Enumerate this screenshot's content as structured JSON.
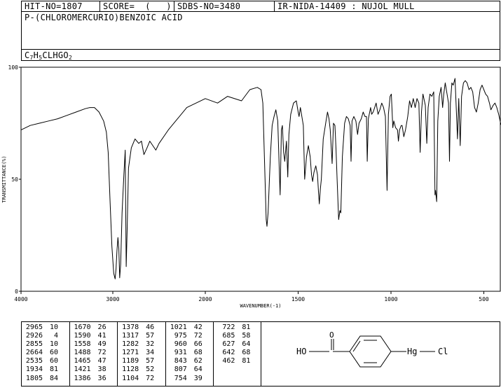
{
  "header": {
    "hit_no": "HIT-NO=1807",
    "score": "SCORE=  (   )",
    "sdbs_no": "SDBS-NO=3480",
    "ir_info": "IR-NIDA-14409 : NUJOL MULL"
  },
  "compound": {
    "name": "P-(CHLOROMERCURIO)BENZOIC ACID",
    "formula_parts": [
      "C",
      "7",
      "H",
      "5",
      "CLHGO",
      "2"
    ]
  },
  "chart_data": {
    "type": "line",
    "xlabel": "WAVENUMBER(-1)",
    "ylabel": "TRANSMITTANCE(%)",
    "xlim": [
      4000,
      400
    ],
    "ylim": [
      0,
      100
    ],
    "x_ticks": [
      4000,
      3000,
      2000,
      1500,
      1000,
      500
    ],
    "y_ticks": [
      0,
      50,
      100
    ],
    "grid": false,
    "series": [
      {
        "points": [
          [
            4000,
            72
          ],
          [
            3900,
            74
          ],
          [
            3800,
            75
          ],
          [
            3700,
            76
          ],
          [
            3600,
            77
          ],
          [
            3500,
            78.5
          ],
          [
            3400,
            80
          ],
          [
            3300,
            81.5
          ],
          [
            3250,
            82
          ],
          [
            3200,
            82
          ],
          [
            3150,
            80
          ],
          [
            3100,
            76
          ],
          [
            3070,
            71
          ],
          [
            3050,
            62
          ],
          [
            3030,
            40
          ],
          [
            3010,
            20
          ],
          [
            2990,
            8
          ],
          [
            2975,
            5.5
          ],
          [
            2965,
            10
          ],
          [
            2955,
            18
          ],
          [
            2945,
            24
          ],
          [
            2935,
            19
          ],
          [
            2926,
            6
          ],
          [
            2915,
            12
          ],
          [
            2900,
            35
          ],
          [
            2880,
            52
          ],
          [
            2866,
            63
          ],
          [
            2855,
            11
          ],
          [
            2845,
            28
          ],
          [
            2830,
            55
          ],
          [
            2800,
            64
          ],
          [
            2760,
            68
          ],
          [
            2720,
            66
          ],
          [
            2690,
            67
          ],
          [
            2664,
            61
          ],
          [
            2630,
            64
          ],
          [
            2600,
            67
          ],
          [
            2535,
            63
          ],
          [
            2500,
            66
          ],
          [
            2400,
            72
          ],
          [
            2300,
            77
          ],
          [
            2200,
            82
          ],
          [
            2100,
            84
          ],
          [
            2000,
            86
          ],
          [
            1934,
            84
          ],
          [
            1880,
            87
          ],
          [
            1805,
            85
          ],
          [
            1760,
            90
          ],
          [
            1720,
            91
          ],
          [
            1700,
            90
          ],
          [
            1690,
            84
          ],
          [
            1680,
            55
          ],
          [
            1672,
            32
          ],
          [
            1668,
            29
          ],
          [
            1662,
            35
          ],
          [
            1650,
            60
          ],
          [
            1640,
            74
          ],
          [
            1630,
            78
          ],
          [
            1620,
            81
          ],
          [
            1610,
            76
          ],
          [
            1602,
            55
          ],
          [
            1597,
            43
          ],
          [
            1590,
            72
          ],
          [
            1585,
            74
          ],
          [
            1578,
            62
          ],
          [
            1572,
            58
          ],
          [
            1563,
            67
          ],
          [
            1556,
            51
          ],
          [
            1550,
            70
          ],
          [
            1540,
            79
          ],
          [
            1525,
            84
          ],
          [
            1510,
            85
          ],
          [
            1500,
            80
          ],
          [
            1495,
            78
          ],
          [
            1488,
            82
          ],
          [
            1480,
            78
          ],
          [
            1472,
            74
          ],
          [
            1465,
            50
          ],
          [
            1455,
            60
          ],
          [
            1445,
            65
          ],
          [
            1435,
            60
          ],
          [
            1428,
            52
          ],
          [
            1422,
            49
          ],
          [
            1415,
            53
          ],
          [
            1405,
            56
          ],
          [
            1396,
            52
          ],
          [
            1390,
            44
          ],
          [
            1386,
            39
          ],
          [
            1380,
            46
          ],
          [
            1375,
            50
          ],
          [
            1365,
            68
          ],
          [
            1350,
            76
          ],
          [
            1342,
            80
          ],
          [
            1334,
            77
          ],
          [
            1327,
            72
          ],
          [
            1317,
            57
          ],
          [
            1310,
            75
          ],
          [
            1302,
            74
          ],
          [
            1296,
            63
          ],
          [
            1290,
            50
          ],
          [
            1282,
            32
          ],
          [
            1275,
            36
          ],
          [
            1270,
            35
          ],
          [
            1262,
            60
          ],
          [
            1250,
            75
          ],
          [
            1240,
            78
          ],
          [
            1230,
            77
          ],
          [
            1220,
            74
          ],
          [
            1215,
            58
          ],
          [
            1210,
            76
          ],
          [
            1200,
            78
          ],
          [
            1189,
            76
          ],
          [
            1180,
            70
          ],
          [
            1172,
            75
          ],
          [
            1160,
            77
          ],
          [
            1150,
            80
          ],
          [
            1140,
            78
          ],
          [
            1132,
            78
          ],
          [
            1128,
            58
          ],
          [
            1122,
            77
          ],
          [
            1110,
            82
          ],
          [
            1104,
            79
          ],
          [
            1096,
            80
          ],
          [
            1080,
            84
          ],
          [
            1070,
            79
          ],
          [
            1060,
            81
          ],
          [
            1050,
            84
          ],
          [
            1040,
            82
          ],
          [
            1030,
            78
          ],
          [
            1021,
            45
          ],
          [
            1014,
            79
          ],
          [
            1005,
            87
          ],
          [
            998,
            88
          ],
          [
            990,
            73
          ],
          [
            985,
            76
          ],
          [
            975,
            73
          ],
          [
            965,
            72
          ],
          [
            960,
            67
          ],
          [
            954,
            72
          ],
          [
            945,
            74
          ],
          [
            940,
            74
          ],
          [
            931,
            69
          ],
          [
            922,
            72
          ],
          [
            910,
            78
          ],
          [
            900,
            85
          ],
          [
            890,
            82
          ],
          [
            880,
            86
          ],
          [
            870,
            82
          ],
          [
            860,
            86
          ],
          [
            850,
            84
          ],
          [
            843,
            62
          ],
          [
            836,
            80
          ],
          [
            828,
            88
          ],
          [
            815,
            83
          ],
          [
            807,
            66
          ],
          [
            800,
            82
          ],
          [
            790,
            88
          ],
          [
            780,
            87
          ],
          [
            770,
            89
          ],
          [
            763,
            43
          ],
          [
            760,
            45
          ],
          [
            754,
            40
          ],
          [
            748,
            76
          ],
          [
            740,
            87
          ],
          [
            730,
            91
          ],
          [
            722,
            82
          ],
          [
            716,
            88
          ],
          [
            708,
            93
          ],
          [
            700,
            89
          ],
          [
            690,
            84
          ],
          [
            685,
            58
          ],
          [
            680,
            84
          ],
          [
            672,
            93
          ],
          [
            665,
            92
          ],
          [
            655,
            95
          ],
          [
            642,
            68
          ],
          [
            635,
            86
          ],
          [
            627,
            65
          ],
          [
            620,
            87
          ],
          [
            610,
            93
          ],
          [
            600,
            94
          ],
          [
            590,
            93
          ],
          [
            580,
            90
          ],
          [
            570,
            91
          ],
          [
            560,
            89
          ],
          [
            550,
            82
          ],
          [
            540,
            80
          ],
          [
            530,
            84
          ],
          [
            520,
            90
          ],
          [
            510,
            92
          ],
          [
            500,
            90
          ],
          [
            490,
            88
          ],
          [
            480,
            87
          ],
          [
            470,
            84
          ],
          [
            462,
            81
          ],
          [
            450,
            83
          ],
          [
            440,
            84
          ],
          [
            430,
            82
          ],
          [
            420,
            79
          ],
          [
            410,
            75
          ],
          [
            400,
            73
          ]
        ]
      }
    ]
  },
  "peak_columns": [
    [
      [
        "2965",
        "10"
      ],
      [
        "2926",
        "4"
      ],
      [
        "2855",
        "10"
      ],
      [
        "2664",
        "60"
      ],
      [
        "2535",
        "60"
      ],
      [
        "1934",
        "81"
      ],
      [
        "1805",
        "84"
      ]
    ],
    [
      [
        "1670",
        "26"
      ],
      [
        "1590",
        "41"
      ],
      [
        "1558",
        "49"
      ],
      [
        "1488",
        "72"
      ],
      [
        "1465",
        "47"
      ],
      [
        "1421",
        "38"
      ],
      [
        "1386",
        "36"
      ]
    ],
    [
      [
        "1378",
        "46"
      ],
      [
        "1317",
        "57"
      ],
      [
        "1282",
        "32"
      ],
      [
        "1271",
        "34"
      ],
      [
        "1189",
        "57"
      ],
      [
        "1128",
        "52"
      ],
      [
        "1104",
        "72"
      ]
    ],
    [
      [
        "1021",
        "42"
      ],
      [
        "975",
        "72"
      ],
      [
        "960",
        "66"
      ],
      [
        "931",
        "68"
      ],
      [
        "843",
        "62"
      ],
      [
        "807",
        "64"
      ],
      [
        "754",
        "39"
      ]
    ],
    [
      [
        "722",
        "81"
      ],
      [
        "685",
        "58"
      ],
      [
        "627",
        "64"
      ],
      [
        "642",
        "68"
      ],
      [
        "462",
        "81"
      ]
    ]
  ],
  "structure": {
    "left_label": "HO",
    "right_label": "Hg",
    "end_label": "Cl"
  }
}
